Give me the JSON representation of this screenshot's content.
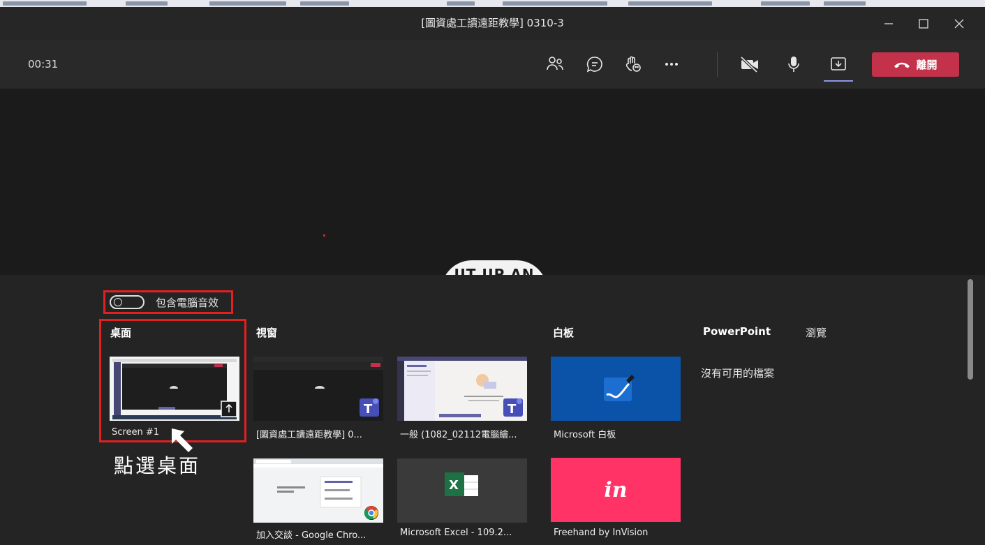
{
  "window": {
    "title": "[圖資處工讀遠距教學] 0310-3",
    "controls": {
      "minimize": "minimize-icon",
      "maximize": "maximize-icon",
      "close": "close-icon"
    }
  },
  "toolbar": {
    "timer": "00:31",
    "icons": [
      "people-icon",
      "chat-icon",
      "raise-hand-icon",
      "more-icon",
      "camera-off-icon",
      "microphone-icon",
      "share-tray-icon"
    ],
    "leave_label": "離開",
    "leave_color": "#c4314b",
    "share_active_color": "#8f94e3"
  },
  "stage": {
    "logo_text": "UT UP AN"
  },
  "share_tray": {
    "include_audio_label": "包含電腦音效",
    "include_audio_on": false,
    "sections": {
      "desktop": "桌面",
      "window": "視窗",
      "whiteboard": "白板",
      "powerpoint": "PowerPoint",
      "browse": "瀏覽"
    },
    "no_files": "沒有可用的檔案",
    "desktop_items": [
      {
        "caption": "Screen #1"
      }
    ],
    "window_items": [
      {
        "caption": "[圖資處工讀遠距教學] 0..."
      },
      {
        "caption": "一般 (1082_02112電腦繪..."
      },
      {
        "caption": "加入交談 - Google Chro..."
      },
      {
        "caption": "Microsoft Excel - 109.2..."
      }
    ],
    "whiteboard_items": [
      {
        "caption": "Microsoft 白板",
        "color": "#0b53a8"
      },
      {
        "caption": "Freehand by InVision",
        "color": "#ff3366",
        "logo": "in"
      }
    ]
  },
  "annotation": {
    "text": "點選桌面",
    "highlight_color": "#e32020"
  }
}
